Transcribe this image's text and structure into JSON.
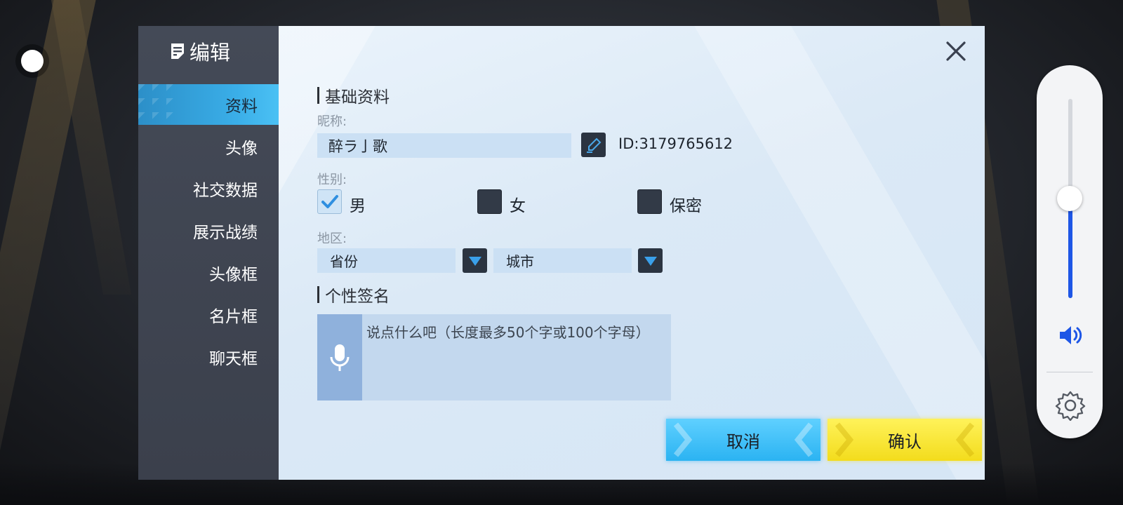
{
  "sidebar": {
    "title": "编辑",
    "items": [
      {
        "label": "资料",
        "active": true
      },
      {
        "label": "头像",
        "active": false
      },
      {
        "label": "社交数据",
        "active": false
      },
      {
        "label": "展示战绩",
        "active": false
      },
      {
        "label": "头像框",
        "active": false
      },
      {
        "label": "名片框",
        "active": false
      },
      {
        "label": "聊天框",
        "active": false
      }
    ]
  },
  "profile": {
    "section_basic": "基础资料",
    "nickname_label": "昵称:",
    "nickname_value": "醉ラ亅歌",
    "id_text": "ID:3179765612",
    "gender_label": "性别:",
    "gender_options": [
      {
        "label": "男",
        "checked": true
      },
      {
        "label": "女",
        "checked": false
      },
      {
        "label": "保密",
        "checked": false
      }
    ],
    "region_label": "地区:",
    "province_value": "省份",
    "city_value": "城市",
    "section_signature": "个性签名",
    "signature_placeholder": "说点什么吧（长度最多50个字或100个字母）"
  },
  "buttons": {
    "cancel_label": "取消",
    "confirm_label": "确认"
  },
  "side_controls": {
    "volume_level": 0.5
  },
  "icons": {
    "close": "close-icon",
    "edit": "pencil-icon",
    "mic": "microphone-icon",
    "dropdown": "triangle-down-icon",
    "volume": "volume-icon",
    "settings": "gear-icon"
  },
  "colors": {
    "accent_blue": "#2bb3f2",
    "accent_yellow": "#f3dc1c",
    "sidebar_bg": "#3f4450",
    "panel_bg": "#dbe9f6"
  }
}
